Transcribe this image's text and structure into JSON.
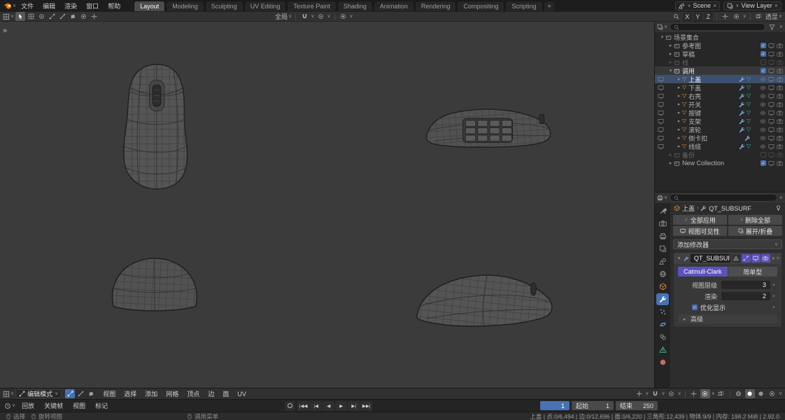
{
  "colors": {
    "accent_blue": "#4772b3",
    "modifier_purple": "#5b52bd",
    "object_orange": "#e8913c",
    "mesh_teal": "#2fbc8e",
    "viewport_bg": "#3b3b3b"
  },
  "icons": {
    "expand": "▸",
    "collapse": "▾",
    "dropdown": "∨",
    "close": "×",
    "check": "✓",
    "dot": "•",
    "mesh_tri": "▽",
    "crumb_sep": "›",
    "toolbar_expand": "»"
  },
  "topbar": {
    "menus": [
      "文件",
      "编辑",
      "渲染",
      "窗口",
      "帮助"
    ],
    "tabs": [
      "Layout",
      "Modeling",
      "Sculpting",
      "UV Editing",
      "Texture Paint",
      "Shading",
      "Animation",
      "Rendering",
      "Compositing",
      "Scripting"
    ],
    "new_tab_label": "+",
    "scene_name": "Scene",
    "view_layer_name": "View Layer"
  },
  "viewport_header": {
    "orientation_label": "全局",
    "mirror_x": "X",
    "mirror_y": "Y",
    "mirror_z": "Z",
    "xray_label": "透显"
  },
  "outliner": {
    "scene_collection": "场景集合",
    "collections": [
      "参考图",
      "草稿",
      "线"
    ],
    "active_collection": "调用",
    "objects": [
      "上盖",
      "下盖",
      "右壳",
      "开关",
      "按键",
      "支架",
      "滚轮",
      "侧卡扣",
      "线缆"
    ],
    "collections_after": [
      "备份",
      "New Collection"
    ]
  },
  "properties": {
    "tab_icons": [
      "tool",
      "render",
      "output",
      "view-layer",
      "scene",
      "world",
      "object",
      "modifiers",
      "particles",
      "physics",
      "constraints",
      "object-data",
      "material"
    ],
    "active_object": "上盖",
    "breadcrumb_modifier": "QT_SUBSURF",
    "apply_all": "全部应用",
    "delete_all": "删除全部",
    "viewport_visibility": "视图可见性",
    "expand_collapse": "展开/折叠",
    "add_modifier": "添加修改器",
    "modifier": {
      "name": "QT_SUBSURF",
      "subdivision_catmull": "Catmull-Clark",
      "subdivision_simple": "简单型",
      "levels_viewport_label": "视图层级",
      "levels_viewport": "3",
      "render_label": "渲染",
      "render_levels": "2",
      "optimal_display_label": "优化显示",
      "advanced_label": "高级"
    }
  },
  "edit_header": {
    "mode": "编辑模式",
    "menus": [
      "视图",
      "选择",
      "添加",
      "网格",
      "顶点",
      "边",
      "面",
      "UV"
    ]
  },
  "timeline": {
    "menus": [
      "回放",
      "关键帧",
      "视图",
      "标记"
    ],
    "playback": [
      "|◀◀",
      "|◀",
      "◀",
      "▶",
      "▶|",
      "▶▶|"
    ],
    "current_frame": "1",
    "start_label": "起始",
    "start_value": "1",
    "end_label": "结束",
    "end_value": "250"
  },
  "statusbar": {
    "hint_select": "选择",
    "hint_rotate": "旋转视图",
    "hint_menu": "调用菜单",
    "stats_line": "上盖 | 点:0/6,494 | 边:0/12,696 | 面:0/6,220 | 三角形:12,439 | 物体:9/9 | 内存: 198.2 MiB | 2.92.0"
  }
}
